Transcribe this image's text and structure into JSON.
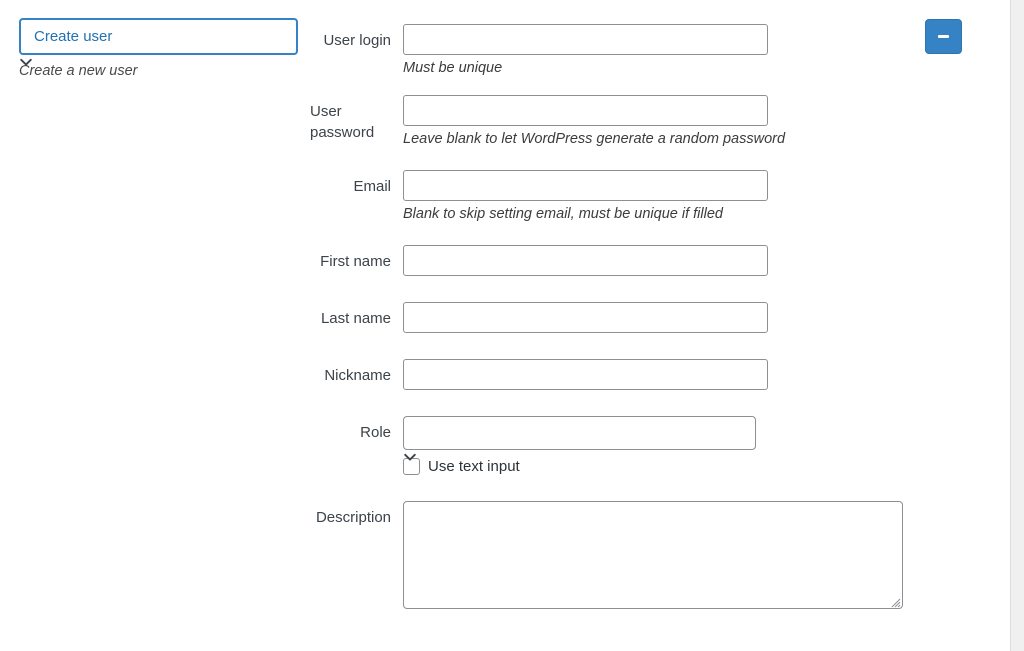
{
  "action_panel": {
    "selected_action": "Create user",
    "hint": "Create a new user",
    "chevron_icon": "chevron-down-icon"
  },
  "remove_button": {
    "label": "-",
    "icon": "minus-icon",
    "color": "#3582c4"
  },
  "form": {
    "fields": [
      {
        "label": "User login",
        "value": "",
        "hint": "Must be unique",
        "type": "text"
      },
      {
        "label": "User password",
        "value": "",
        "hint": "Leave blank to let WordPress generate a random password",
        "type": "text"
      },
      {
        "label": "Email",
        "value": "",
        "hint": "Blank to skip setting email, must be unique if filled",
        "type": "text"
      },
      {
        "label": "First name",
        "value": "",
        "hint": "",
        "type": "text"
      },
      {
        "label": "Last name",
        "value": "",
        "hint": "",
        "type": "text"
      },
      {
        "label": "Nickname",
        "value": "",
        "hint": "",
        "type": "text"
      },
      {
        "label": "Role",
        "value": "",
        "hint": "",
        "type": "select",
        "chevron_icon": "chevron-down-icon",
        "checkbox": {
          "label": "Use text input",
          "checked": false
        }
      },
      {
        "label": "Description",
        "value": "",
        "hint": "",
        "type": "textarea",
        "resize_icon": "resize-grip-icon"
      }
    ]
  },
  "colors": {
    "accent": "#3582c4",
    "select_text": "#2271b1",
    "border": "#8c8f94",
    "text": "#3c434a",
    "gutter": "#f0f0f1"
  }
}
